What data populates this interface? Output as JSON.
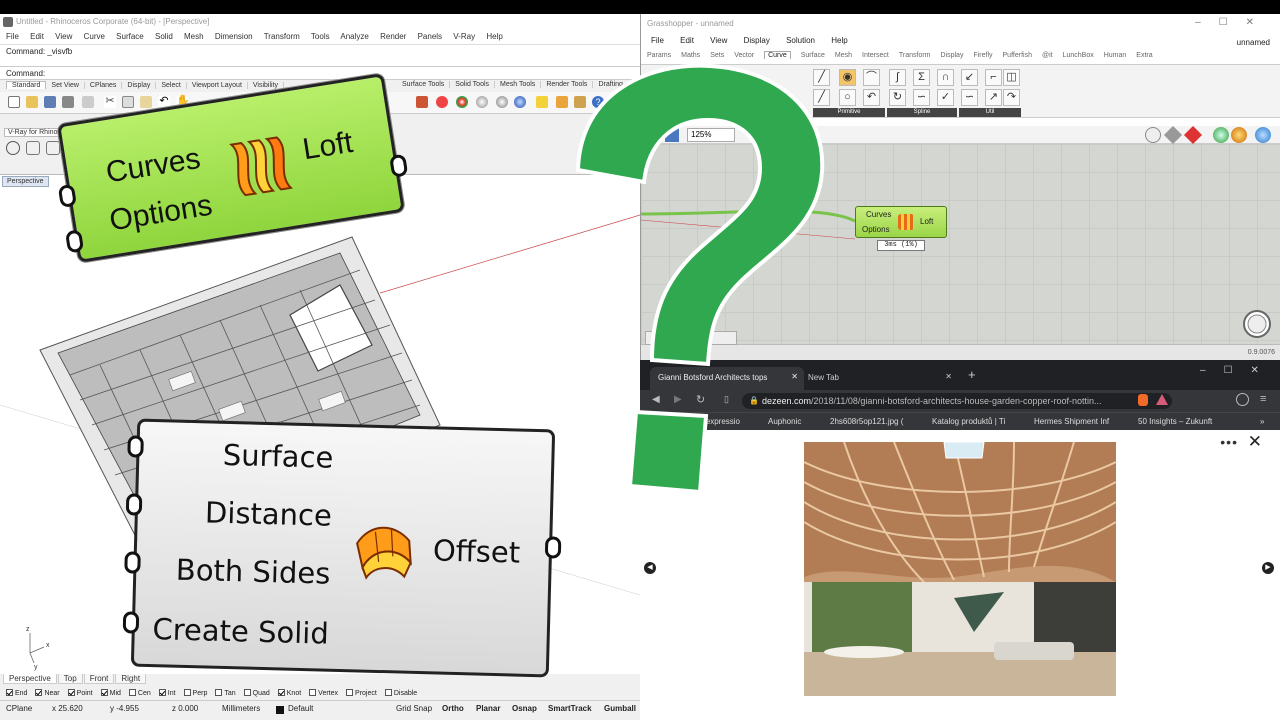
{
  "rhino": {
    "title": "Untitled - Rhinoceros Corporate (64-bit) - [Perspective]",
    "menu": [
      "File",
      "Edit",
      "View",
      "Curve",
      "Surface",
      "Solid",
      "Mesh",
      "Dimension",
      "Transform",
      "Tools",
      "Analyze",
      "Render",
      "Panels",
      "V-Ray",
      "Help"
    ],
    "command_history": "Command: _visvfb",
    "command_prompt": "Command:",
    "toolbar_tabs": [
      "Standard",
      "Set View",
      "CPlanes",
      "Display",
      "Select",
      "Viewport Layout",
      "Visibility"
    ],
    "toolbar_tabs_right": [
      "Surface Tools",
      "Solid Tools",
      "Mesh Tools",
      "Render Tools",
      "Drafting"
    ],
    "vray_panel": "V-Ray for Rhino",
    "viewport_label": "Perspective",
    "viewport_tabs": [
      "Perspective",
      "Top",
      "Front",
      "Right"
    ],
    "osnaps": [
      {
        "label": "End",
        "checked": true
      },
      {
        "label": "Near",
        "checked": true
      },
      {
        "label": "Point",
        "checked": true
      },
      {
        "label": "Mid",
        "checked": true
      },
      {
        "label": "Cen",
        "checked": false
      },
      {
        "label": "Int",
        "checked": true
      },
      {
        "label": "Perp",
        "checked": false
      },
      {
        "label": "Tan",
        "checked": false
      },
      {
        "label": "Quad",
        "checked": false
      },
      {
        "label": "Knot",
        "checked": true
      },
      {
        "label": "Vertex",
        "checked": false
      },
      {
        "label": "Project",
        "checked": false
      },
      {
        "label": "Disable",
        "checked": false
      }
    ],
    "status": {
      "cplane": "CPlane",
      "x": "x 25.620",
      "y": "y -4.955",
      "z": "z 0.000",
      "units": "Millimeters",
      "layer": "Default",
      "grid_snap": "Grid Snap",
      "ortho": "Ortho",
      "planar": "Planar",
      "osnap": "Osnap",
      "smarttrack": "SmartTrack",
      "gumball": "Gumball"
    },
    "axis_labels": {
      "z": "z",
      "x": "x",
      "y": "y"
    }
  },
  "grasshopper": {
    "title": "Grasshopper - unnamed",
    "doc_name": "unnamed",
    "menu": [
      "File",
      "Edit",
      "View",
      "Display",
      "Solution",
      "Help"
    ],
    "tabs": [
      "Params",
      "Maths",
      "Sets",
      "Vector",
      "Curve",
      "Surface",
      "Mesh",
      "Intersect",
      "Transform",
      "Display",
      "Firefly",
      "Pufferfish",
      "@it",
      "LunchBox",
      "Human",
      "Extra"
    ],
    "active_tab": "Curve",
    "ribbon_groups": [
      "Primitive",
      "Spline",
      "Util"
    ],
    "zoom": "125%",
    "loft_component": {
      "input1": "Curves",
      "input2": "Options",
      "output": "Loft"
    },
    "timer": "3ms (1%)",
    "version": "0.9.0076"
  },
  "browser": {
    "tab1": "Gianni Botsford Architects tops Ho",
    "tab2": "New Tab",
    "url_host": "dezeen.com",
    "url_path": "/2018/11/08/gianni-botsford-architects-house-garden-copper-roof-nottin...",
    "bookmarks": [
      "Ice Cube's expressio",
      "Auphonic",
      "2hs608r5op121.jpg (",
      "Katalog produktů | Ti",
      "Hermes Shipment Inf",
      "50 Insights – Zukunft"
    ],
    "more_menu": "•••",
    "close": "✕"
  },
  "overlay": {
    "loft": {
      "input1": "Curves",
      "input2": "Options",
      "output": "Loft",
      "icon": "loft-icon"
    },
    "offset": {
      "input1": "Surface",
      "input2": "Distance",
      "input3": "Both Sides",
      "input4": "Create Solid",
      "output": "Offset",
      "icon": "offset-surface-icon"
    },
    "question_mark": "?",
    "colors": {
      "question": "#2fa84f",
      "loft_green": "#9fdd4c",
      "offset_grey": "#e4e4e4"
    }
  }
}
